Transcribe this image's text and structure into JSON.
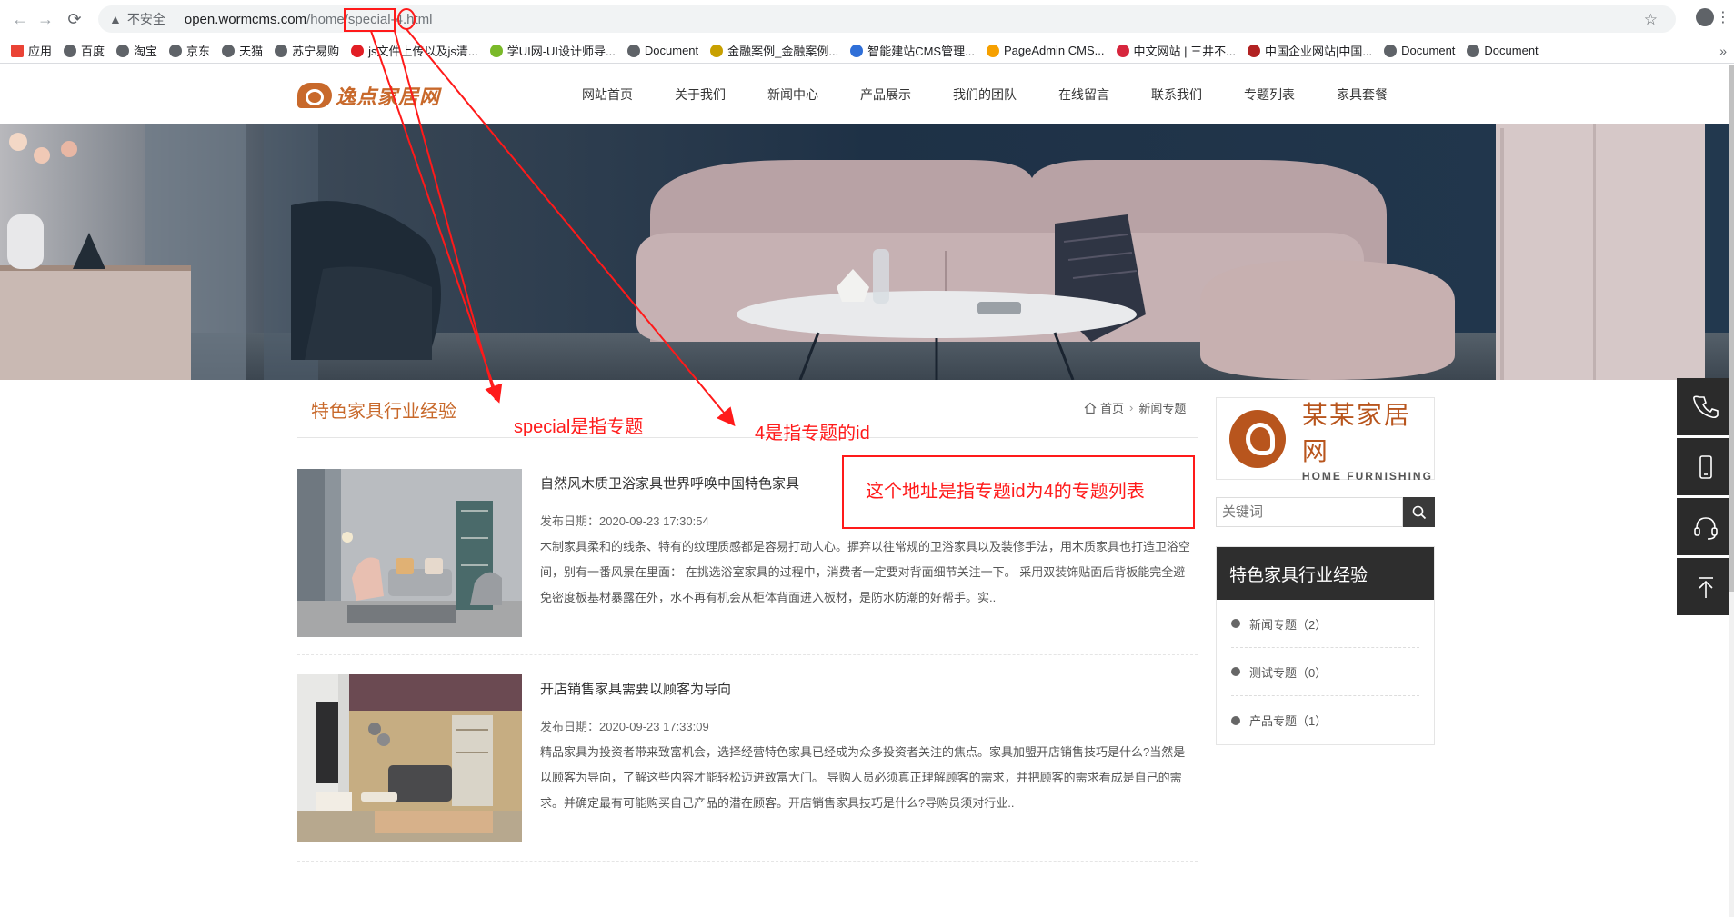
{
  "browser": {
    "insecure_label": "不安全",
    "url_host": "open.wormcms.com",
    "url_path": "/home/special-4.html"
  },
  "bookmarks": [
    {
      "label": "应用",
      "icon": "apps-grid-icon",
      "color": "#ea4335"
    },
    {
      "label": "百度",
      "icon": "globe-icon",
      "color": "#5f6368"
    },
    {
      "label": "淘宝",
      "icon": "globe-icon",
      "color": "#5f6368"
    },
    {
      "label": "京东",
      "icon": "globe-icon",
      "color": "#5f6368"
    },
    {
      "label": "天猫",
      "icon": "globe-icon",
      "color": "#5f6368"
    },
    {
      "label": "苏宁易购",
      "icon": "globe-icon",
      "color": "#5f6368"
    },
    {
      "label": "js文件上传以及js清...",
      "icon": "c-logo-icon",
      "color": "#e21e25"
    },
    {
      "label": "学UI网-UI设计师导...",
      "icon": "leaf-icon",
      "color": "#7ab929"
    },
    {
      "label": "Document",
      "icon": "globe-icon",
      "color": "#5f6368"
    },
    {
      "label": "金融案例_金融案例...",
      "icon": "coin-icon",
      "color": "#c8a000"
    },
    {
      "label": "智能建站CMS管理...",
      "icon": "paw-icon",
      "color": "#2f6fd8"
    },
    {
      "label": "PageAdmin CMS...",
      "icon": "pa-logo-icon",
      "color": "#f6a000"
    },
    {
      "label": "中文网站 | 三井不...",
      "icon": "person-icon",
      "color": "#d7263d"
    },
    {
      "label": "中国企业网站|中国...",
      "icon": "shield-logo-icon",
      "color": "#b22222"
    },
    {
      "label": "Document",
      "icon": "globe-icon",
      "color": "#5f6368"
    },
    {
      "label": "Document",
      "icon": "globe-icon",
      "color": "#5f6368"
    }
  ],
  "site": {
    "logo_text": "逸点家居网",
    "nav": [
      "网站首页",
      "关于我们",
      "新闻中心",
      "产品展示",
      "我们的团队",
      "在线留言",
      "联系我们",
      "专题列表",
      "家具套餐"
    ],
    "accent_color": "#c8692b"
  },
  "content": {
    "section_title": "特色家具行业经验",
    "breadcrumb": {
      "home": "首页",
      "current": "新闻专题"
    },
    "articles": [
      {
        "title": "自然风木质卫浴家具世界呼唤中国特色家具",
        "date": "发布日期：2020-09-23 17:30:54",
        "summary": "木制家具柔和的线条、特有的纹理质感都是容易打动人心。摒弃以往常规的卫浴家具以及装修手法，用木质家具也打造卫浴空间，别有一番风景在里面： 在挑选浴室家具的过程中，消费者一定要对背面细节关注一下。 采用双装饰贴面后背板能完全避免密度板基材暴露在外，水不再有机会从柜体背面进入板材，是防水防潮的好帮手。实.."
      },
      {
        "title": "开店销售家具需要以顾客为导向",
        "date": "发布日期：2020-09-23 17:33:09",
        "summary": "精品家具为投资者带来致富机会，选择经营特色家具已经成为众多投资者关注的焦点。家具加盟开店销售技巧是什么?当然是以顾客为导向，了解这些内容才能轻松迈进致富大门。 导购人员必须真正理解顾客的需求，并把顾客的需求看成是自己的需求。并确定最有可能购买自己产品的潜在顾客。开店销售家具技巧是什么?导购员须对行业.."
      }
    ]
  },
  "sidebar": {
    "logo_cn": "某某家居网",
    "logo_en": "HOME FURNISHING",
    "search_placeholder": "关键词",
    "category_title": "特色家具行业经验",
    "categories": [
      "新闻专题（2）",
      "测试专题（0）",
      "产品专题（1）"
    ]
  },
  "float_bar": [
    "phone-icon",
    "mobile-icon",
    "headset-icon",
    "back-to-top-icon"
  ],
  "annotations": {
    "special_note": "special是指专题",
    "id_note": "4是指专题的id",
    "box_note": "这个地址是指专题id为4的专题列表",
    "color": "#ff1a1a"
  }
}
